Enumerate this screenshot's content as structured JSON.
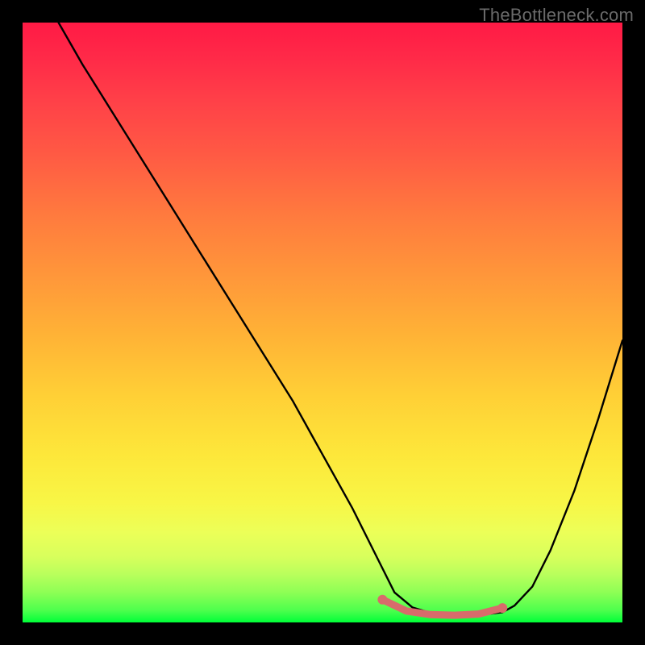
{
  "watermark": "TheBottleneck.com",
  "chart_data": {
    "type": "line",
    "title": "",
    "xlabel": "",
    "ylabel": "",
    "xlim": [
      0,
      100
    ],
    "ylim": [
      0,
      100
    ],
    "grid": false,
    "series": [
      {
        "name": "curve",
        "x": [
          6,
          10,
          15,
          20,
          25,
          30,
          35,
          40,
          45,
          50,
          55,
          60,
          62,
          65,
          68,
          72,
          76,
          80,
          82,
          85,
          88,
          92,
          96,
          100
        ],
        "y": [
          100,
          93,
          85,
          77,
          69,
          61,
          53,
          45,
          37,
          28,
          19,
          9,
          5,
          2.5,
          1.6,
          1.2,
          1.2,
          1.7,
          2.8,
          6,
          12,
          22,
          34,
          47
        ]
      }
    ],
    "highlight": {
      "name": "optimal-range",
      "x": [
        60,
        64,
        68,
        72,
        76,
        80
      ],
      "y": [
        3.8,
        1.9,
        1.3,
        1.2,
        1.4,
        2.4
      ],
      "color": "#d86b6b"
    },
    "background_gradient": {
      "top": "#ff1a45",
      "bottom": "#00ff38"
    }
  }
}
